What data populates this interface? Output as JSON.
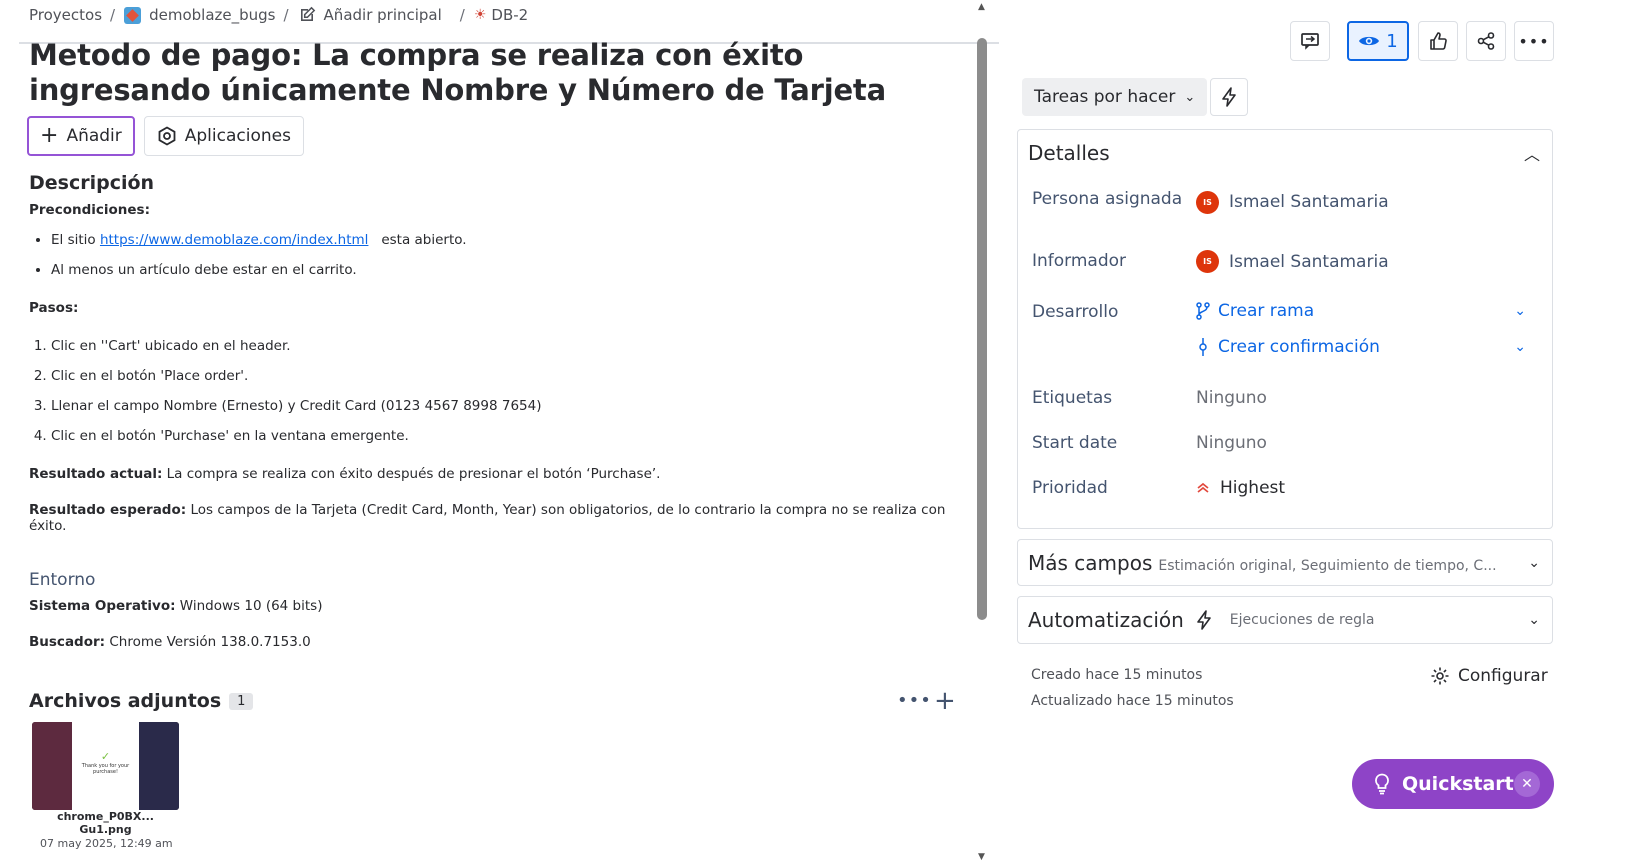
{
  "breadcrumb": {
    "root": "Proyectos",
    "project": "demoblaze_bugs",
    "add_parent": "Añadir principal",
    "issue_key": "DB-2",
    "separator": "/"
  },
  "issue": {
    "title": "Metodo de pago: La compra se realiza con éxito ingresando únicamente Nombre y Número de Tarjeta",
    "add_button": "Añadir",
    "apps_button": "Aplicaciones"
  },
  "description": {
    "heading": "Descripción",
    "preconditions_label": "Precondiciones:",
    "preconditions": [
      {
        "prefix": "El sitio ",
        "link": "https://www.demoblaze.com/index.html",
        "suffix": "esta abierto."
      },
      {
        "prefix": "Al menos un artículo debe estar en el carrito.",
        "link": "",
        "suffix": ""
      }
    ],
    "steps_label": "Pasos:",
    "steps": [
      "Clic en ''Cart' ubicado en el header.",
      "Clic en el botón 'Place order'.",
      "Llenar el campo Nombre (Ernesto) y Credit Card (0123 4567 8998 7654)",
      "Clic en el botón 'Purchase' en la ventana emergente."
    ],
    "actual_label": "Resultado actual:",
    "actual_text": "La compra se realiza con éxito después de presionar el botón ‘Purchase’.",
    "expected_label": "Resultado esperado:",
    "expected_text": "Los campos de la Tarjeta (Credit Card, Month, Year) son obligatorios, de lo contrario la compra no se realiza con éxito."
  },
  "environment": {
    "heading": "Entorno",
    "os_label": "Sistema Operativo:",
    "os_value": "Windows 10 (64 bits)",
    "browser_label": "Buscador:",
    "browser_value": "Chrome Versión 138.0.7153.0"
  },
  "attachments": {
    "heading": "Archivos adjuntos",
    "count": "1",
    "file_name": "chrome_P0BX... Gu1.png",
    "file_date": "07 may 2025, 12:49 am",
    "thumb_text": "Thank you for your purchase!"
  },
  "toolbar": {
    "watch_count": "1"
  },
  "status": {
    "label": "Tareas por hacer"
  },
  "details": {
    "heading": "Detalles",
    "assignee_label": "Persona asignada",
    "assignee": "Ismael Santamaria",
    "assignee_initials": "IS",
    "reporter_label": "Informador",
    "reporter": "Ismael Santamaria",
    "reporter_initials": "IS",
    "development_label": "Desarrollo",
    "create_branch": "Crear rama",
    "create_commit": "Crear confirmación",
    "labels_label": "Etiquetas",
    "labels_value": "Ninguno",
    "start_date_label": "Start date",
    "start_date_value": "Ninguno",
    "priority_label": "Prioridad",
    "priority_value": "Highest"
  },
  "more_fields": {
    "heading": "Más campos",
    "hint": "Estimación original, Seguimiento de tiempo, C..."
  },
  "automation": {
    "heading": "Automatización",
    "hint": "Ejecuciones de regla"
  },
  "meta": {
    "created": "Creado hace 15 minutos",
    "updated": "Actualizado hace 15 minutos",
    "configure": "Configurar"
  },
  "quickstart": {
    "label": "Quickstart"
  },
  "colors": {
    "accent_purple": "#8e44c7",
    "link_blue": "#0c66e4",
    "priority_red": "#e2483d",
    "avatar_red": "#de350b"
  }
}
